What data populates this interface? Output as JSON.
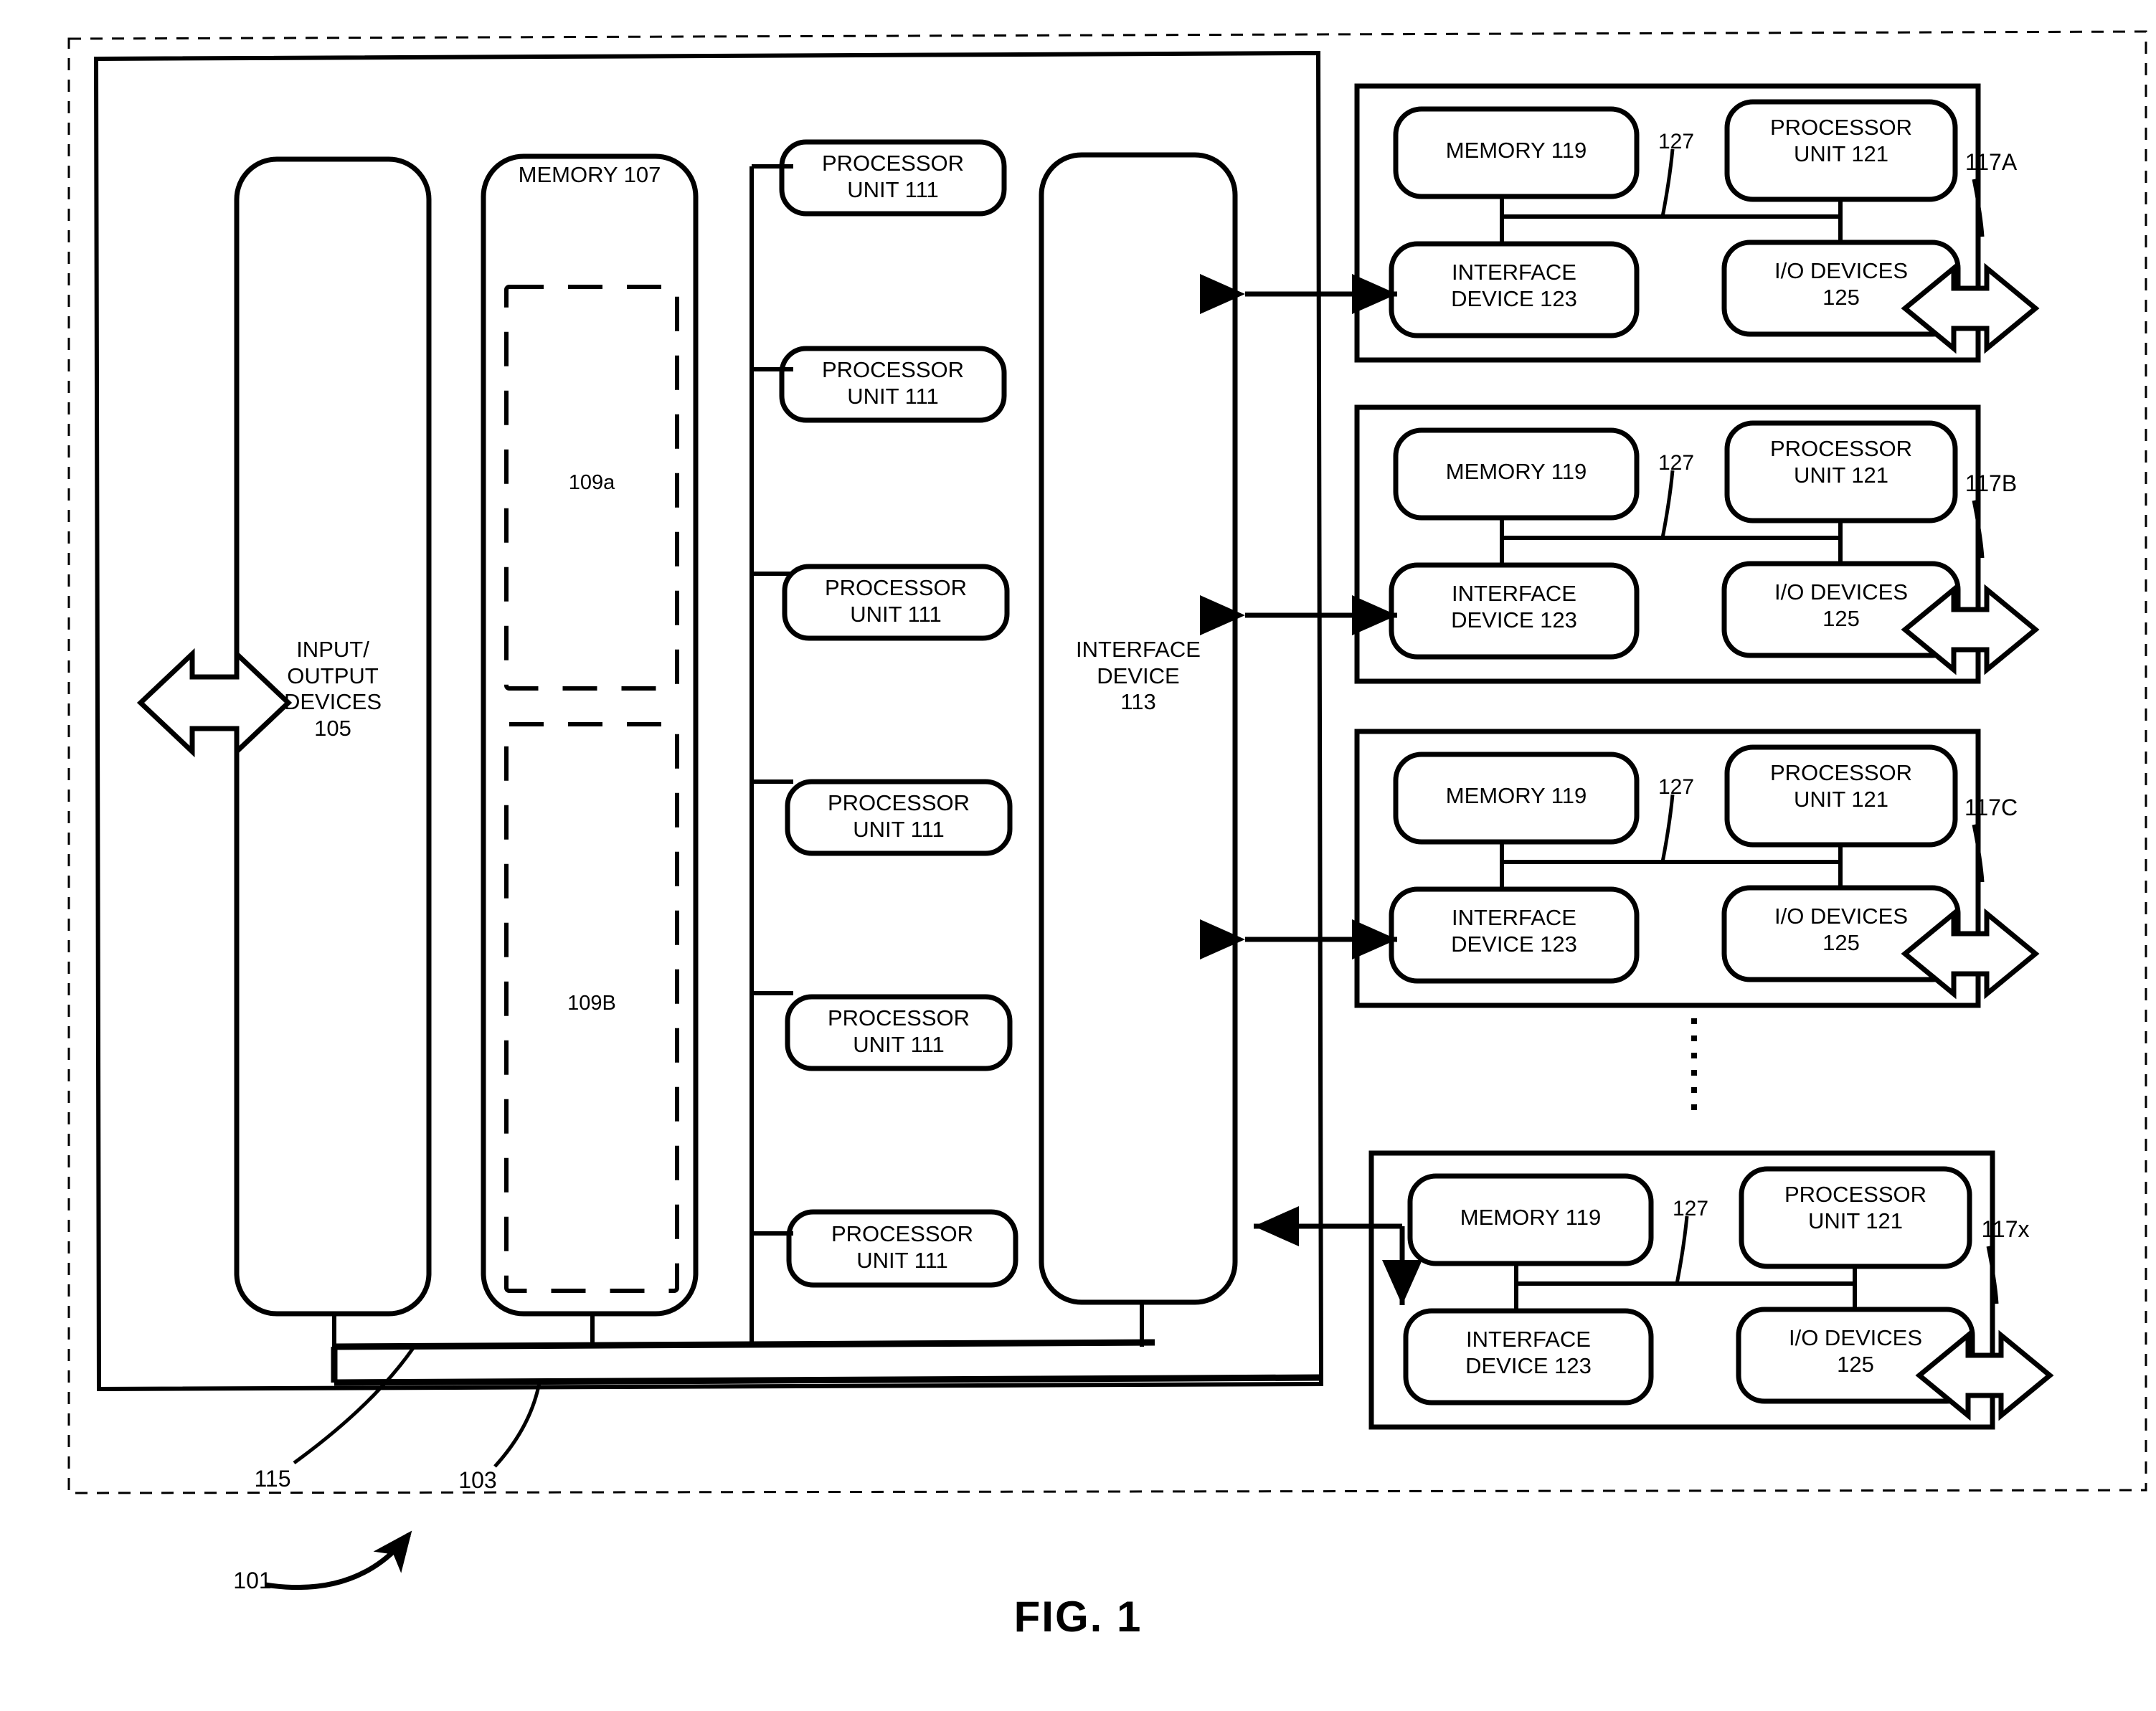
{
  "figure": {
    "caption": "FIG. 1",
    "system_ref": "101",
    "computer_ref": "103",
    "bus_ref": "115"
  },
  "computer": {
    "io_devices": {
      "label": "INPUT/\nOUTPUT\nDEVICES\n105",
      "ref": "105"
    },
    "memory": {
      "label": "MEMORY 107",
      "ref": "107",
      "regions": [
        {
          "label": "109a"
        },
        {
          "label": "109B"
        }
      ]
    },
    "processor_units": [
      {
        "label": "PROCESSOR\nUNIT 111"
      },
      {
        "label": "PROCESSOR\nUNIT 111"
      },
      {
        "label": "PROCESSOR\nUNIT 111"
      },
      {
        "label": "PROCESSOR\nUNIT 111"
      },
      {
        "label": "PROCESSOR\nUNIT 111"
      },
      {
        "label": "PROCESSOR\nUNIT 111"
      }
    ],
    "interface_device": {
      "label": "INTERFACE\nDEVICE\n113",
      "ref": "113"
    }
  },
  "nodes": [
    {
      "ref": "117A",
      "memory": "MEMORY 119",
      "processor": "PROCESSOR\nUNIT 121",
      "interface": "INTERFACE\nDEVICE 123",
      "io": "I/O DEVICES\n125",
      "bus_ref": "127"
    },
    {
      "ref": "117B",
      "memory": "MEMORY 119",
      "processor": "PROCESSOR\nUNIT 121",
      "interface": "INTERFACE\nDEVICE 123",
      "io": "I/O DEVICES\n125",
      "bus_ref": "127"
    },
    {
      "ref": "117C",
      "memory": "MEMORY 119",
      "processor": "PROCESSOR\nUNIT 121",
      "interface": "INTERFACE\nDEVICE 123",
      "io": "I/O DEVICES\n125",
      "bus_ref": "127"
    },
    {
      "ref": "117x",
      "memory": "MEMORY 119",
      "processor": "PROCESSOR\nUNIT 121",
      "interface": "INTERFACE\nDEVICE 123",
      "io": "I/O DEVICES\n125",
      "bus_ref": "127"
    }
  ],
  "colors": {
    "ink": "#000000",
    "paper": "#ffffff"
  }
}
